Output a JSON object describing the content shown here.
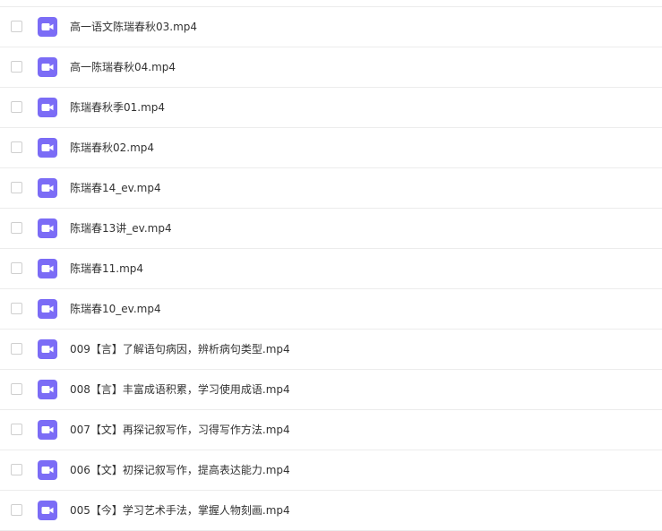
{
  "colors": {
    "video_icon": "#7b6cf6",
    "row_border": "#ececec",
    "text": "#333333"
  },
  "files": [
    {
      "name": "高一语文陈瑞春秋03.mp4",
      "icon": "video-file-icon"
    },
    {
      "name": "高一陈瑞春秋04.mp4",
      "icon": "video-file-icon"
    },
    {
      "name": "陈瑞春秋季01.mp4",
      "icon": "video-file-icon"
    },
    {
      "name": "陈瑞春秋02.mp4",
      "icon": "video-file-icon"
    },
    {
      "name": "陈瑞春14_ev.mp4",
      "icon": "video-file-icon"
    },
    {
      "name": "陈瑞春13讲_ev.mp4",
      "icon": "video-file-icon"
    },
    {
      "name": "陈瑞春11.mp4",
      "icon": "video-file-icon"
    },
    {
      "name": "陈瑞春10_ev.mp4",
      "icon": "video-file-icon"
    },
    {
      "name": "009【言】了解语句病因，辨析病句类型.mp4",
      "icon": "video-file-icon"
    },
    {
      "name": "008【言】丰富成语积累，学习使用成语.mp4",
      "icon": "video-file-icon"
    },
    {
      "name": "007【文】再探记叙写作，习得写作方法.mp4",
      "icon": "video-file-icon"
    },
    {
      "name": "006【文】初探记叙写作，提高表达能力.mp4",
      "icon": "video-file-icon"
    },
    {
      "name": "005【今】学习艺术手法，掌握人物刻画.mp4",
      "icon": "video-file-icon"
    }
  ]
}
